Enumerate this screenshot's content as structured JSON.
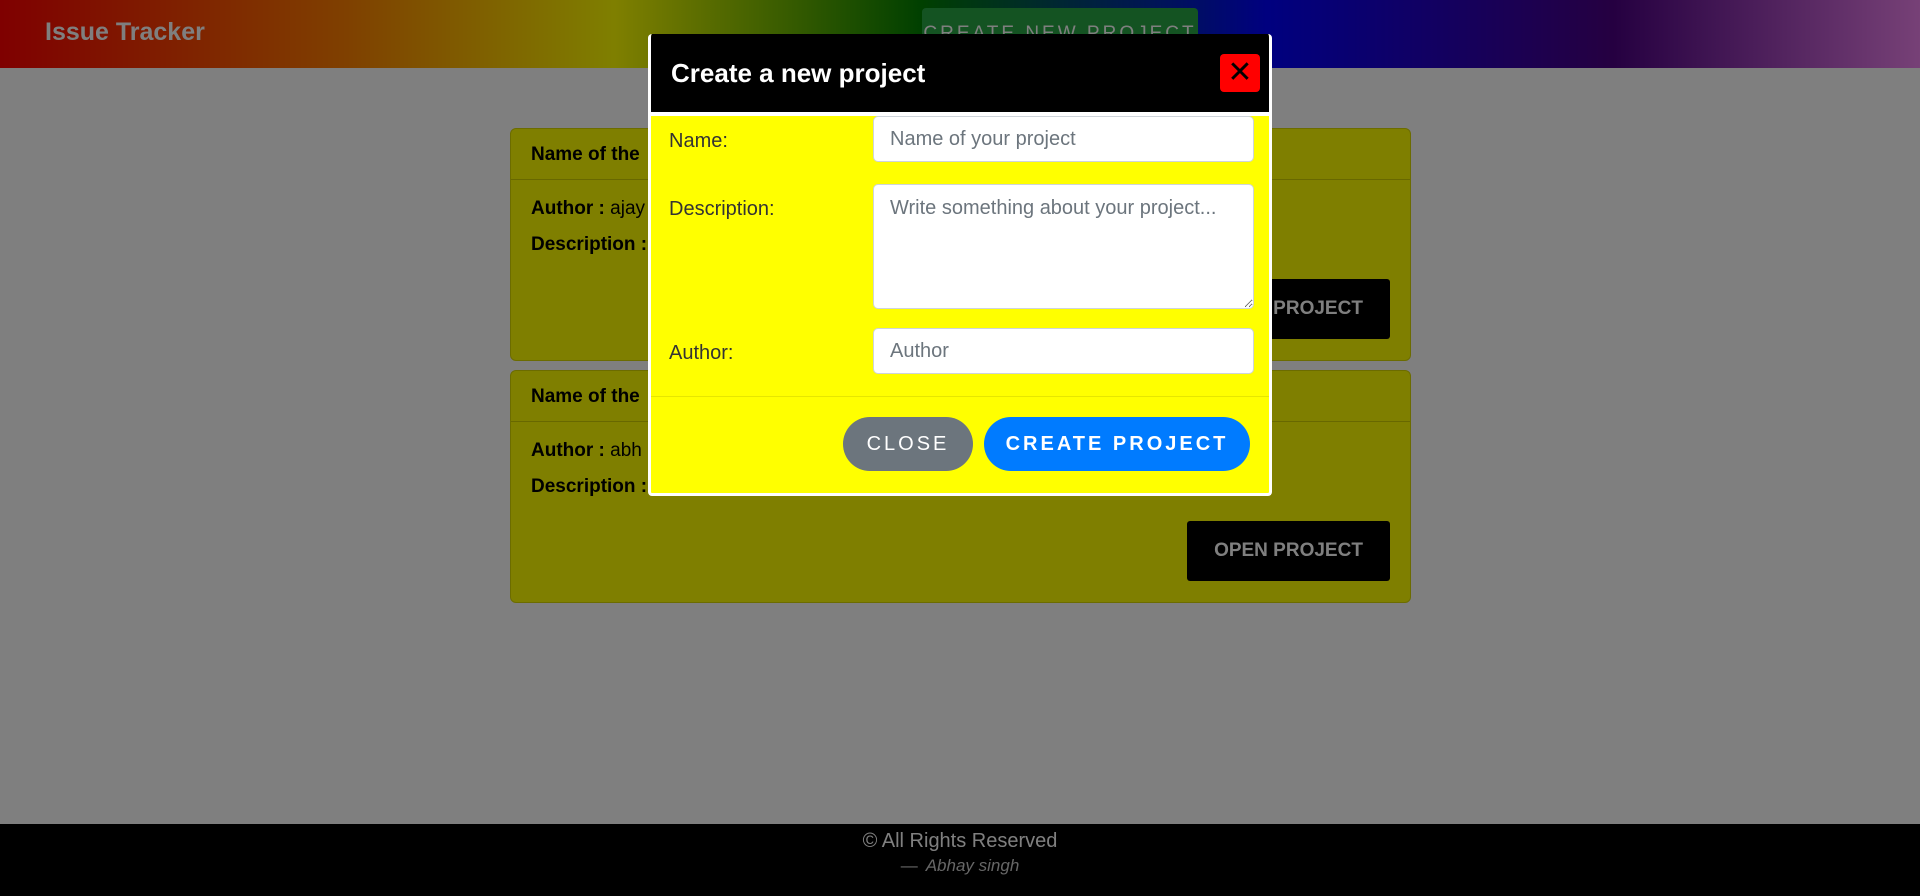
{
  "navbar": {
    "brand": "Issue Tracker",
    "create_button_label": "CREATE NEW PROJECT"
  },
  "projects": [
    {
      "header": "Name of the",
      "author_label": "Author :",
      "author_value": "ajay",
      "description_label": "Description :",
      "description_value": "",
      "open_button_label": "OPEN PROJECT"
    },
    {
      "header": "Name of the",
      "author_label": "Author :",
      "author_value": "abh",
      "description_label": "Description :",
      "description_value": "",
      "open_button_label": "OPEN PROJECT"
    }
  ],
  "modal": {
    "title": "Create a new project",
    "close_icon": "✕",
    "fields": {
      "name_label": "Name:",
      "name_placeholder": "Name of your project",
      "description_label": "Description:",
      "description_placeholder": "Write something about your project...",
      "author_label": "Author:",
      "author_placeholder": "Author"
    },
    "close_button_label": "CLOSE",
    "create_button_label": "CREATE PROJECT"
  },
  "footer": {
    "copyright": "© All Rights Reserved",
    "author_dash": "—",
    "author": "Abhay singh"
  },
  "colors": {
    "card_bg": "#ffff00",
    "modal_bg": "#ffff00",
    "close_x_bg": "#ff0000",
    "create_button": "#007bff",
    "close_button": "#6c757d",
    "nav_button": "#28a745"
  }
}
